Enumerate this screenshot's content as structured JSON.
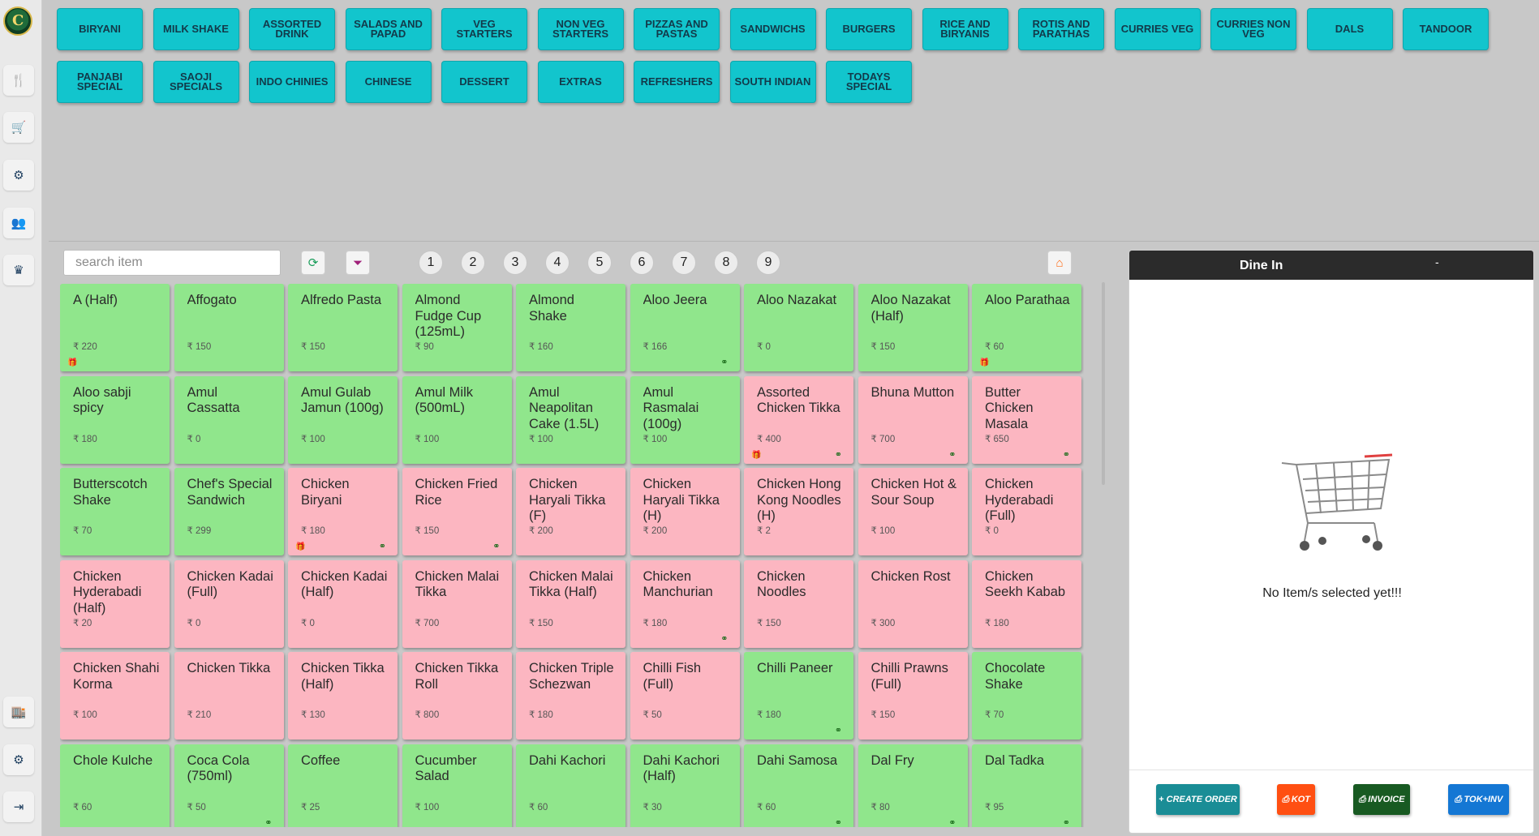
{
  "app": {
    "logo_text": "C"
  },
  "rail": {
    "items": [
      {
        "name": "menu",
        "icon": "🍴"
      },
      {
        "name": "cart",
        "icon": "🛒"
      },
      {
        "name": "orders",
        "icon": "⚙"
      },
      {
        "name": "customers",
        "icon": "👥"
      },
      {
        "name": "premium",
        "icon": "♛"
      },
      {
        "name": "store",
        "icon": "🏬"
      },
      {
        "name": "settings",
        "icon": "⚙"
      },
      {
        "name": "logout",
        "icon": "⇥"
      }
    ]
  },
  "categories": [
    "BIRYANI",
    "MILK SHAKE",
    "ASSORTED DRINK",
    "SALADS AND PAPAD",
    "VEG STARTERS",
    "NON VEG STARTERS",
    "PIZZAS AND PASTAS",
    "SANDWICHS",
    "BURGERS",
    "RICE AND BIRYANIS",
    "ROTIS AND PARATHAS",
    "CURRIES VEG",
    "CURRIES NON VEG",
    "DALS",
    "TANDOOR",
    "PANJABI SPECIAL",
    "SAOJI SPECIALS",
    "INDO CHINIES",
    "CHINESE",
    "DESSERT",
    "EXTRAS",
    "REFRESHERS",
    "SOUTH INDIAN",
    "TODAYS SPECIAL"
  ],
  "search": {
    "placeholder": "search item",
    "value": ""
  },
  "pages": [
    "1",
    "2",
    "3",
    "4",
    "5",
    "6",
    "7",
    "8",
    "9"
  ],
  "currency": "₹",
  "items": [
    {
      "name": "A (Half)",
      "price": "220",
      "type": "veg",
      "gift": true,
      "combo": false
    },
    {
      "name": "Affogato",
      "price": "150",
      "type": "veg",
      "gift": false,
      "combo": false
    },
    {
      "name": "Alfredo Pasta",
      "price": "150",
      "type": "veg",
      "gift": false,
      "combo": false
    },
    {
      "name": "Almond Fudge Cup (125mL)",
      "price": "90",
      "type": "veg",
      "gift": false,
      "combo": false
    },
    {
      "name": "Almond Shake",
      "price": "160",
      "type": "veg",
      "gift": false,
      "combo": false
    },
    {
      "name": "Aloo Jeera",
      "price": "166",
      "type": "veg",
      "gift": false,
      "combo": true
    },
    {
      "name": "Aloo Nazakat",
      "price": "0",
      "type": "veg",
      "gift": false,
      "combo": false
    },
    {
      "name": "Aloo Nazakat (Half)",
      "price": "150",
      "type": "veg",
      "gift": false,
      "combo": false
    },
    {
      "name": "Aloo Parathaa",
      "price": "60",
      "type": "veg",
      "gift": true,
      "combo": false
    },
    {
      "name": "Aloo sabji spicy",
      "price": "180",
      "type": "veg",
      "gift": false,
      "combo": false
    },
    {
      "name": "Amul Cassatta",
      "price": "0",
      "type": "veg",
      "gift": false,
      "combo": false
    },
    {
      "name": "Amul Gulab Jamun (100g)",
      "price": "100",
      "type": "veg",
      "gift": false,
      "combo": false
    },
    {
      "name": "Amul Milk (500mL)",
      "price": "100",
      "type": "veg",
      "gift": false,
      "combo": false
    },
    {
      "name": "Amul Neapolitan Cake (1.5L)",
      "price": "100",
      "type": "veg",
      "gift": false,
      "combo": false
    },
    {
      "name": "Amul Rasmalai (100g)",
      "price": "100",
      "type": "veg",
      "gift": false,
      "combo": false
    },
    {
      "name": "Assorted Chicken Tikka",
      "price": "400",
      "type": "nonveg",
      "gift": true,
      "combo": true
    },
    {
      "name": "Bhuna Mutton",
      "price": "700",
      "type": "nonveg",
      "gift": false,
      "combo": true
    },
    {
      "name": "Butter Chicken Masala",
      "price": "650",
      "type": "nonveg",
      "gift": false,
      "combo": true
    },
    {
      "name": "Butterscotch Shake",
      "price": "70",
      "type": "veg",
      "gift": false,
      "combo": false
    },
    {
      "name": "Chef's Special Sandwich",
      "price": "299",
      "type": "veg",
      "gift": false,
      "combo": false
    },
    {
      "name": "Chicken Biryani",
      "price": "180",
      "type": "nonveg",
      "gift": true,
      "combo": true
    },
    {
      "name": "Chicken Fried Rice",
      "price": "150",
      "type": "nonveg",
      "gift": false,
      "combo": true
    },
    {
      "name": "Chicken Haryali Tikka (F)",
      "price": "200",
      "type": "nonveg",
      "gift": false,
      "combo": false
    },
    {
      "name": "Chicken Haryali Tikka (H)",
      "price": "200",
      "type": "nonveg",
      "gift": false,
      "combo": false
    },
    {
      "name": "Chicken Hong Kong Noodles (H)",
      "price": "2",
      "type": "nonveg",
      "gift": false,
      "combo": false
    },
    {
      "name": "Chicken Hot & Sour Soup",
      "price": "100",
      "type": "nonveg",
      "gift": false,
      "combo": false
    },
    {
      "name": "Chicken Hyderabadi (Full)",
      "price": "0",
      "type": "nonveg",
      "gift": false,
      "combo": false
    },
    {
      "name": "Chicken Hyderabadi (Half)",
      "price": "20",
      "type": "nonveg",
      "gift": false,
      "combo": false
    },
    {
      "name": "Chicken Kadai (Full)",
      "price": "0",
      "type": "nonveg",
      "gift": false,
      "combo": false
    },
    {
      "name": "Chicken Kadai (Half)",
      "price": "0",
      "type": "nonveg",
      "gift": false,
      "combo": false
    },
    {
      "name": "Chicken Malai Tikka",
      "price": "700",
      "type": "nonveg",
      "gift": false,
      "combo": false
    },
    {
      "name": "Chicken Malai Tikka (Half)",
      "price": "150",
      "type": "nonveg",
      "gift": false,
      "combo": false
    },
    {
      "name": "Chicken Manchurian",
      "price": "180",
      "type": "nonveg",
      "gift": false,
      "combo": true
    },
    {
      "name": "Chicken Noodles",
      "price": "150",
      "type": "nonveg",
      "gift": false,
      "combo": false
    },
    {
      "name": "Chicken Rost",
      "price": "300",
      "type": "nonveg",
      "gift": false,
      "combo": false
    },
    {
      "name": "Chicken Seekh Kabab",
      "price": "180",
      "type": "nonveg",
      "gift": false,
      "combo": false
    },
    {
      "name": "Chicken Shahi Korma",
      "price": "100",
      "type": "nonveg",
      "gift": false,
      "combo": false
    },
    {
      "name": "Chicken Tikka",
      "price": "210",
      "type": "nonveg",
      "gift": false,
      "combo": false
    },
    {
      "name": "Chicken Tikka (Half)",
      "price": "130",
      "type": "nonveg",
      "gift": false,
      "combo": false
    },
    {
      "name": "Chicken Tikka Roll",
      "price": "800",
      "type": "nonveg",
      "gift": false,
      "combo": false
    },
    {
      "name": "Chicken Triple Schezwan",
      "price": "180",
      "type": "nonveg",
      "gift": false,
      "combo": false
    },
    {
      "name": "Chilli Fish (Full)",
      "price": "50",
      "type": "nonveg",
      "gift": false,
      "combo": false
    },
    {
      "name": "Chilli Paneer",
      "price": "180",
      "type": "veg",
      "gift": false,
      "combo": true
    },
    {
      "name": "Chilli Prawns (Full)",
      "price": "150",
      "type": "nonveg",
      "gift": false,
      "combo": false
    },
    {
      "name": "Chocolate Shake",
      "price": "70",
      "type": "veg",
      "gift": false,
      "combo": false
    },
    {
      "name": "Chole Kulche",
      "price": "60",
      "type": "veg",
      "gift": false,
      "combo": false
    },
    {
      "name": "Coca Cola (750ml)",
      "price": "50",
      "type": "veg",
      "gift": false,
      "combo": true
    },
    {
      "name": "Coffee",
      "price": "25",
      "type": "veg",
      "gift": false,
      "combo": false
    },
    {
      "name": "Cucumber Salad",
      "price": "100",
      "type": "veg",
      "gift": false,
      "combo": false
    },
    {
      "name": "Dahi Kachori",
      "price": "60",
      "type": "veg",
      "gift": false,
      "combo": false
    },
    {
      "name": "Dahi Kachori (Half)",
      "price": "30",
      "type": "veg",
      "gift": false,
      "combo": false
    },
    {
      "name": "Dahi Samosa",
      "price": "60",
      "type": "veg",
      "gift": false,
      "combo": true
    },
    {
      "name": "Dal Fry",
      "price": "80",
      "type": "veg",
      "gift": false,
      "combo": true
    },
    {
      "name": "Dal Tadka",
      "price": "95",
      "type": "veg",
      "gift": false,
      "combo": true
    }
  ],
  "order": {
    "title": "Dine In",
    "dash": "-",
    "empty_message": "No Item/s selected yet!!!",
    "actions": [
      {
        "label": "+ CREATE ORDER",
        "color": "#1a8d96"
      },
      {
        "label": "⎙ KOT",
        "color": "#ff4f12"
      },
      {
        "label": "⎙ INVOICE",
        "color": "#185a22"
      },
      {
        "label": "⎙ TOK+INV",
        "color": "#1477d4"
      }
    ]
  },
  "colors": {
    "category": "#12c5cd",
    "veg_item": "#90e68c",
    "nonveg_item": "#fcb6c1",
    "home": "#ff6a13"
  }
}
